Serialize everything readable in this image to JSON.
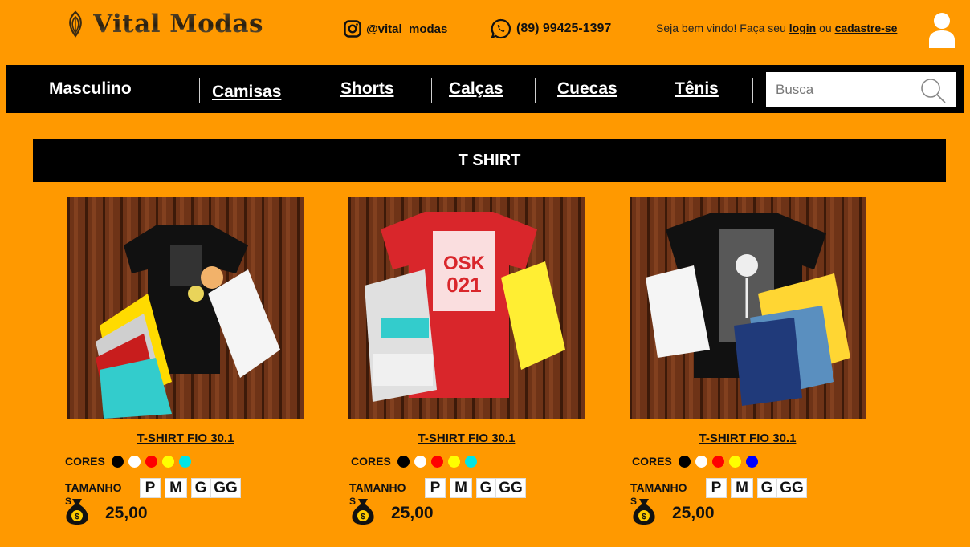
{
  "brand": {
    "name": "Vital Modas"
  },
  "header": {
    "instagram": "@vital_modas",
    "phone": "(89) 99425-1397",
    "welcome_text": "Seja bem vindo! Faça seu",
    "login_label": "login",
    "or_text": "ou",
    "signup_label": "cadastre-se"
  },
  "nav": {
    "items": [
      {
        "label": "Masculino"
      },
      {
        "label": "Camisas"
      },
      {
        "label": "Shorts"
      },
      {
        "label": "Calças"
      },
      {
        "label": "Cuecas"
      },
      {
        "label": "Tênis"
      }
    ],
    "search_placeholder": "Busca"
  },
  "section": {
    "title": "T SHIRT"
  },
  "products": [
    {
      "title": "T-SHIRT FIO 30.1",
      "colors_label": "CORES",
      "colors": [
        "#000000",
        "#ffffff",
        "#ff0000",
        "#ffff00",
        "#00e5e5"
      ],
      "size_label": "TAMANHO",
      "size_label_tail": "S",
      "sizes": [
        "P",
        "M",
        "G",
        "GG"
      ],
      "price": "25,00"
    },
    {
      "title": "T-SHIRT FIO 30.1",
      "colors_label": "CORES",
      "colors": [
        "#000000",
        "#ffffff",
        "#ff0000",
        "#ffff00",
        "#00e5e5"
      ],
      "size_label": "TAMANHO",
      "size_label_tail": "S",
      "sizes": [
        "P",
        "M",
        "G",
        "GG"
      ],
      "price": "25,00"
    },
    {
      "title": "T-SHIRT FIO 30.1",
      "colors_label": "CORES",
      "colors": [
        "#000000",
        "#ffffff",
        "#ff0000",
        "#ffff00",
        "#0000ff"
      ],
      "size_label": "TAMANHO",
      "size_label_tail": "S",
      "sizes": [
        "P",
        "M",
        "G",
        "GG"
      ],
      "price": "25,00"
    }
  ],
  "colors": {
    "background": "#ff9900",
    "nav_bg": "#000000",
    "text": "#111111"
  }
}
